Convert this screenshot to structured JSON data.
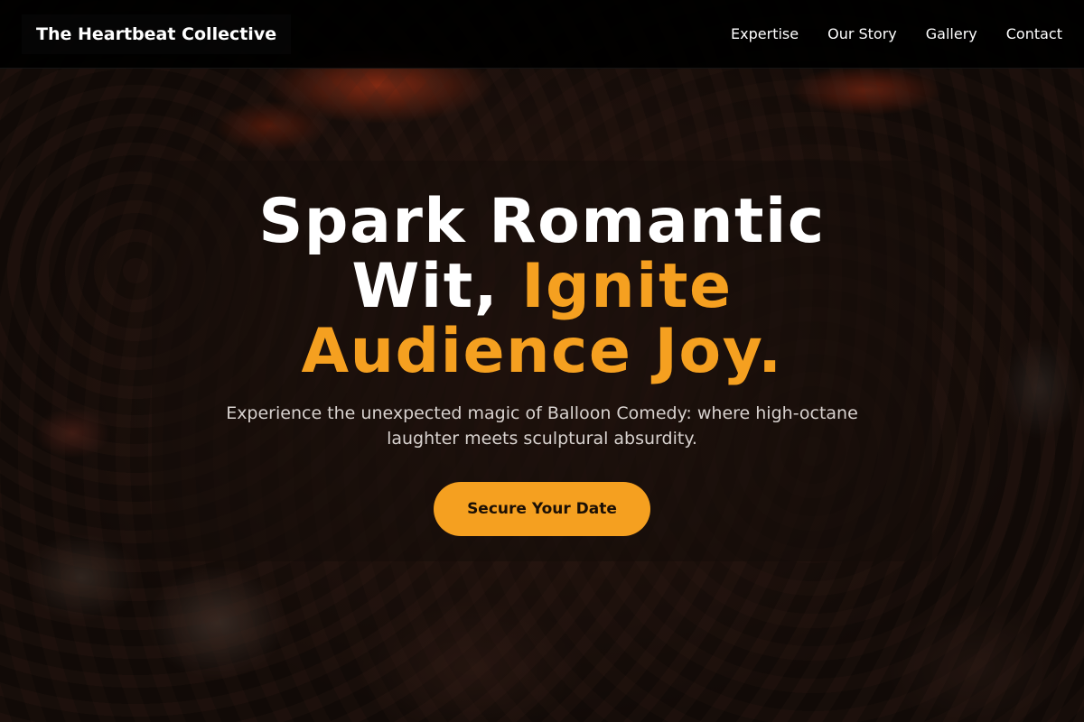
{
  "header": {
    "brand": "The Heartbeat Collective",
    "nav": [
      {
        "label": "Expertise"
      },
      {
        "label": "Our Story"
      },
      {
        "label": "Gallery"
      },
      {
        "label": "Contact"
      }
    ]
  },
  "hero": {
    "headline_line1": "Spark Romantic",
    "headline_white2": "Wit, ",
    "headline_accent2": "Ignite",
    "headline_accent3": "Audience Joy.",
    "subtitle": "Experience the unexpected magic of Balloon Comedy: where high-octane laughter meets sculptural absurdity.",
    "cta_label": "Secure Your Date",
    "background_image": "concert-crowd-photo"
  },
  "colors": {
    "accent": "#f5a020",
    "header_bg": "#000000",
    "text": "#ffffff"
  }
}
